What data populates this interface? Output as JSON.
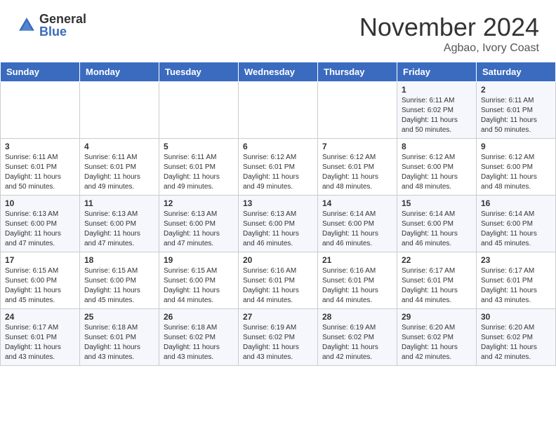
{
  "header": {
    "logo_general": "General",
    "logo_blue": "Blue",
    "month_title": "November 2024",
    "location": "Agbao, Ivory Coast"
  },
  "calendar": {
    "days_of_week": [
      "Sunday",
      "Monday",
      "Tuesday",
      "Wednesday",
      "Thursday",
      "Friday",
      "Saturday"
    ],
    "weeks": [
      [
        {
          "day": "",
          "info": ""
        },
        {
          "day": "",
          "info": ""
        },
        {
          "day": "",
          "info": ""
        },
        {
          "day": "",
          "info": ""
        },
        {
          "day": "",
          "info": ""
        },
        {
          "day": "1",
          "info": "Sunrise: 6:11 AM\nSunset: 6:02 PM\nDaylight: 11 hours\nand 50 minutes."
        },
        {
          "day": "2",
          "info": "Sunrise: 6:11 AM\nSunset: 6:01 PM\nDaylight: 11 hours\nand 50 minutes."
        }
      ],
      [
        {
          "day": "3",
          "info": "Sunrise: 6:11 AM\nSunset: 6:01 PM\nDaylight: 11 hours\nand 50 minutes."
        },
        {
          "day": "4",
          "info": "Sunrise: 6:11 AM\nSunset: 6:01 PM\nDaylight: 11 hours\nand 49 minutes."
        },
        {
          "day": "5",
          "info": "Sunrise: 6:11 AM\nSunset: 6:01 PM\nDaylight: 11 hours\nand 49 minutes."
        },
        {
          "day": "6",
          "info": "Sunrise: 6:12 AM\nSunset: 6:01 PM\nDaylight: 11 hours\nand 49 minutes."
        },
        {
          "day": "7",
          "info": "Sunrise: 6:12 AM\nSunset: 6:01 PM\nDaylight: 11 hours\nand 48 minutes."
        },
        {
          "day": "8",
          "info": "Sunrise: 6:12 AM\nSunset: 6:00 PM\nDaylight: 11 hours\nand 48 minutes."
        },
        {
          "day": "9",
          "info": "Sunrise: 6:12 AM\nSunset: 6:00 PM\nDaylight: 11 hours\nand 48 minutes."
        }
      ],
      [
        {
          "day": "10",
          "info": "Sunrise: 6:13 AM\nSunset: 6:00 PM\nDaylight: 11 hours\nand 47 minutes."
        },
        {
          "day": "11",
          "info": "Sunrise: 6:13 AM\nSunset: 6:00 PM\nDaylight: 11 hours\nand 47 minutes."
        },
        {
          "day": "12",
          "info": "Sunrise: 6:13 AM\nSunset: 6:00 PM\nDaylight: 11 hours\nand 47 minutes."
        },
        {
          "day": "13",
          "info": "Sunrise: 6:13 AM\nSunset: 6:00 PM\nDaylight: 11 hours\nand 46 minutes."
        },
        {
          "day": "14",
          "info": "Sunrise: 6:14 AM\nSunset: 6:00 PM\nDaylight: 11 hours\nand 46 minutes."
        },
        {
          "day": "15",
          "info": "Sunrise: 6:14 AM\nSunset: 6:00 PM\nDaylight: 11 hours\nand 46 minutes."
        },
        {
          "day": "16",
          "info": "Sunrise: 6:14 AM\nSunset: 6:00 PM\nDaylight: 11 hours\nand 45 minutes."
        }
      ],
      [
        {
          "day": "17",
          "info": "Sunrise: 6:15 AM\nSunset: 6:00 PM\nDaylight: 11 hours\nand 45 minutes."
        },
        {
          "day": "18",
          "info": "Sunrise: 6:15 AM\nSunset: 6:00 PM\nDaylight: 11 hours\nand 45 minutes."
        },
        {
          "day": "19",
          "info": "Sunrise: 6:15 AM\nSunset: 6:00 PM\nDaylight: 11 hours\nand 44 minutes."
        },
        {
          "day": "20",
          "info": "Sunrise: 6:16 AM\nSunset: 6:01 PM\nDaylight: 11 hours\nand 44 minutes."
        },
        {
          "day": "21",
          "info": "Sunrise: 6:16 AM\nSunset: 6:01 PM\nDaylight: 11 hours\nand 44 minutes."
        },
        {
          "day": "22",
          "info": "Sunrise: 6:17 AM\nSunset: 6:01 PM\nDaylight: 11 hours\nand 44 minutes."
        },
        {
          "day": "23",
          "info": "Sunrise: 6:17 AM\nSunset: 6:01 PM\nDaylight: 11 hours\nand 43 minutes."
        }
      ],
      [
        {
          "day": "24",
          "info": "Sunrise: 6:17 AM\nSunset: 6:01 PM\nDaylight: 11 hours\nand 43 minutes."
        },
        {
          "day": "25",
          "info": "Sunrise: 6:18 AM\nSunset: 6:01 PM\nDaylight: 11 hours\nand 43 minutes."
        },
        {
          "day": "26",
          "info": "Sunrise: 6:18 AM\nSunset: 6:02 PM\nDaylight: 11 hours\nand 43 minutes."
        },
        {
          "day": "27",
          "info": "Sunrise: 6:19 AM\nSunset: 6:02 PM\nDaylight: 11 hours\nand 43 minutes."
        },
        {
          "day": "28",
          "info": "Sunrise: 6:19 AM\nSunset: 6:02 PM\nDaylight: 11 hours\nand 42 minutes."
        },
        {
          "day": "29",
          "info": "Sunrise: 6:20 AM\nSunset: 6:02 PM\nDaylight: 11 hours\nand 42 minutes."
        },
        {
          "day": "30",
          "info": "Sunrise: 6:20 AM\nSunset: 6:02 PM\nDaylight: 11 hours\nand 42 minutes."
        }
      ]
    ]
  }
}
